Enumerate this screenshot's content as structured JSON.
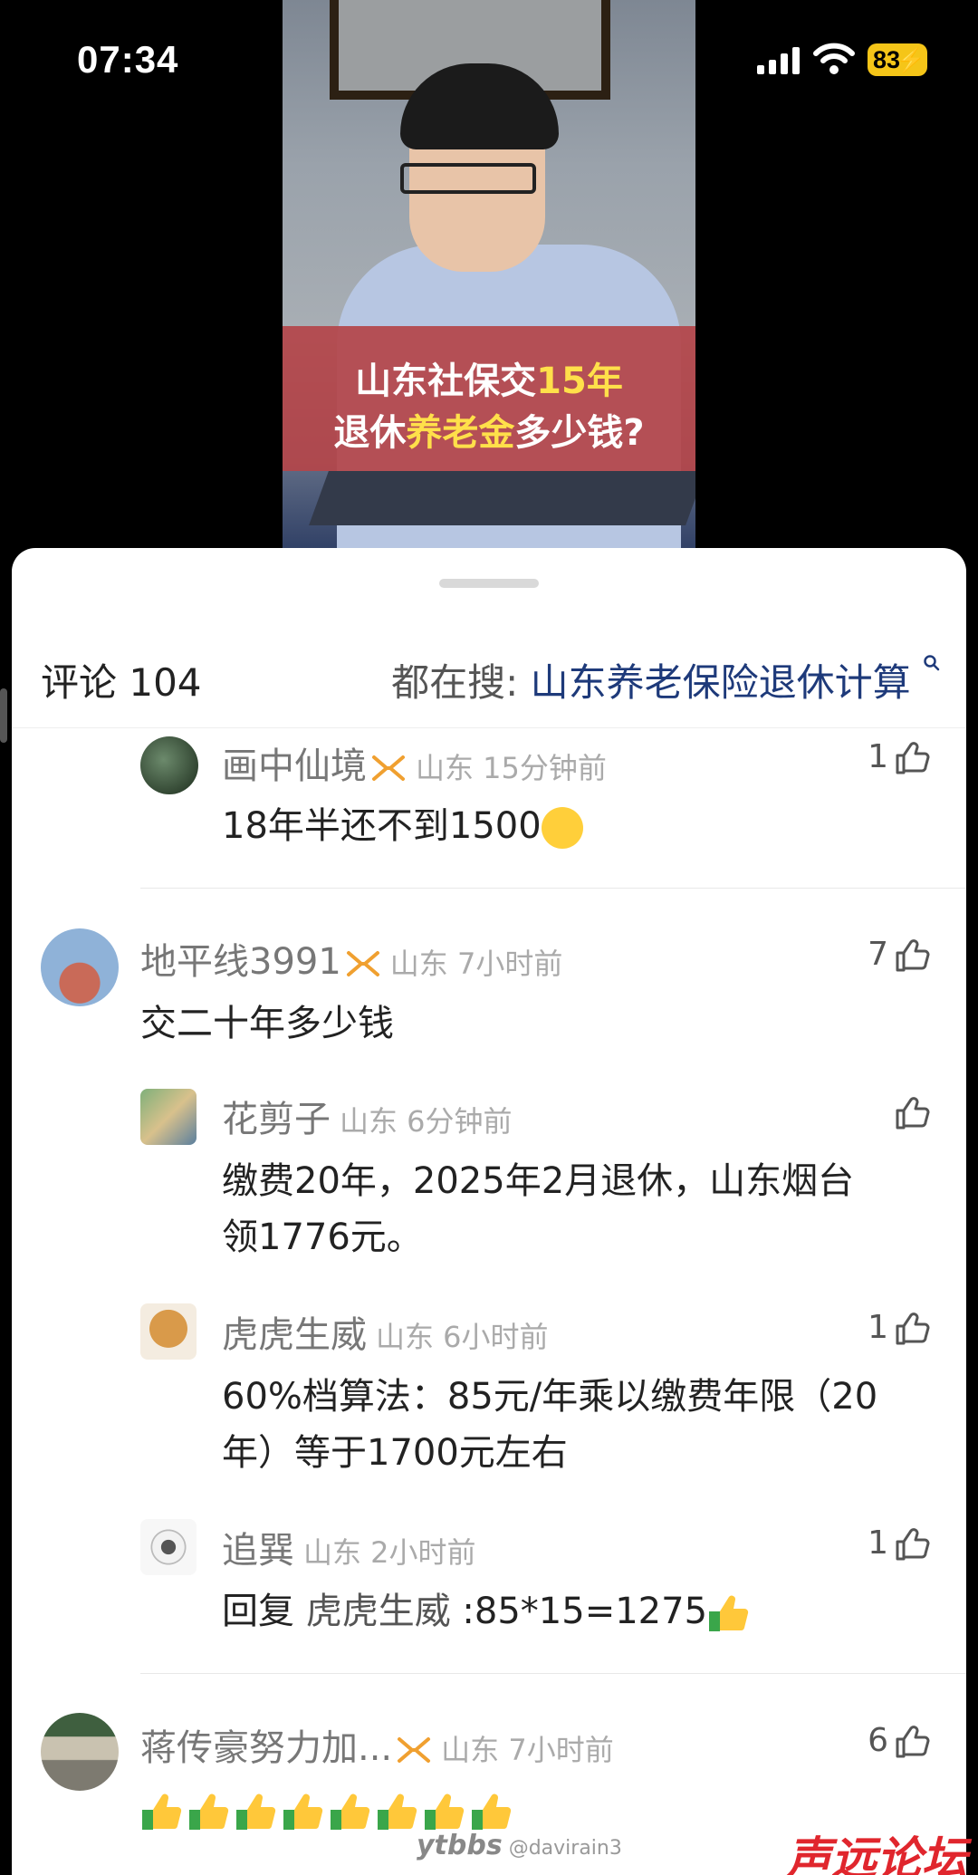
{
  "status": {
    "time": "07:34",
    "battery": "83"
  },
  "video": {
    "title_line1_a": "山东社保交",
    "title_line1_b": "15年",
    "title_line2_a": "退休",
    "title_line2_b": "养老金",
    "title_line2_c": "多少钱?"
  },
  "header": {
    "count_label": "评论 104",
    "search_prefix": "都在搜: ",
    "search_query": "山东养老保险退休计算"
  },
  "comments": [
    {
      "user": "画中仙境",
      "meta": "山东 15分钟前",
      "likes": "1",
      "text": "18年半还不到1500"
    },
    {
      "user": "地平线3991",
      "meta": "山东 7小时前",
      "likes": "7",
      "text": "交二十年多少钱",
      "replies": [
        {
          "user": "花剪子",
          "meta": "山东 6分钟前",
          "likes": "",
          "text_line1": "缴费20年，2025年2月退休，山东烟台",
          "text_line2": "领1776元。"
        },
        {
          "user": "虎虎生威",
          "meta": "山东 6小时前",
          "likes": "1",
          "text_line1": "60%档算法：85元/年乘以缴费年限（20",
          "text_line2": "年）等于1700元左右"
        },
        {
          "user": "追巽",
          "meta": "山东 2小时前",
          "likes": "1",
          "text_prefix": "回复 ",
          "text_mention": "虎虎生威",
          "text_rest": " :85*15=1275"
        }
      ]
    },
    {
      "user": "蒋传豪努力加...",
      "meta": "山东 7小时前",
      "likes": "6"
    }
  ],
  "watermark": {
    "site": "ytbbs",
    "handle": "@davirain3",
    "logo": "声远论坛"
  },
  "colors": {
    "accent_badge": "#f0a030",
    "banner": "#b4464a",
    "highlight": "#ffe04a",
    "search_query": "#1e3a7a"
  }
}
